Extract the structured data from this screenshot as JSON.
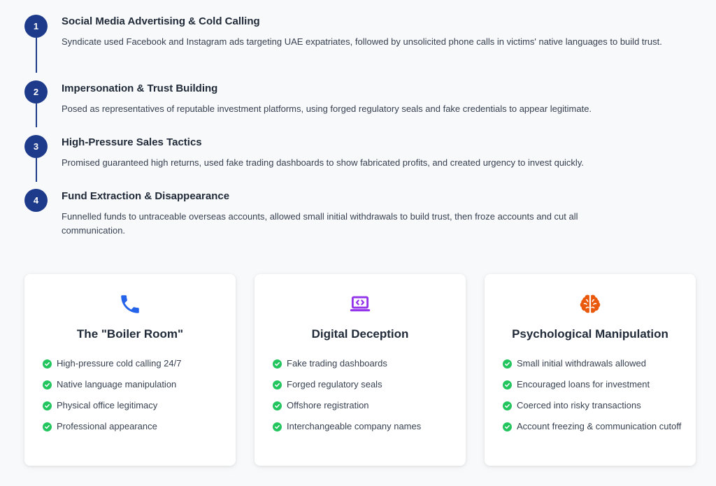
{
  "steps": [
    {
      "number": "1",
      "title": "Social Media Advertising & Cold Calling",
      "description": "Syndicate used Facebook and Instagram ads targeting UAE expatriates, followed by unsolicited phone calls in victims' native languages to build trust."
    },
    {
      "number": "2",
      "title": "Impersonation & Trust Building",
      "description": "Posed as representatives of reputable investment platforms, using forged regulatory seals and fake credentials to appear legitimate."
    },
    {
      "number": "3",
      "title": "High-Pressure Sales Tactics",
      "description": "Promised guaranteed high returns, used fake trading dashboards to show fabricated profits, and created urgency to invest quickly."
    },
    {
      "number": "4",
      "title": "Fund Extraction & Disappearance",
      "description": "Funnelled funds to untraceable overseas accounts, allowed small initial withdrawals to build trust, then froze accounts and cut all communication."
    }
  ],
  "cards": [
    {
      "icon": "phone-icon",
      "icon_color": "#2563eb",
      "title": "The \"Boiler Room\"",
      "items": [
        "High-pressure cold calling 24/7",
        "Native language manipulation",
        "Physical office legitimacy",
        "Professional appearance"
      ]
    },
    {
      "icon": "laptop-code-icon",
      "icon_color": "#9333ea",
      "title": "Digital Deception",
      "items": [
        "Fake trading dashboards",
        "Forged regulatory seals",
        "Offshore registration",
        "Interchangeable company names"
      ]
    },
    {
      "icon": "brain-icon",
      "icon_color": "#ea580c",
      "title": "Psychological Manipulation",
      "items": [
        "Small initial withdrawals allowed",
        "Encouraged loans for investment",
        "Coerced into risky transactions",
        "Account freezing & communication cutoff"
      ]
    }
  ],
  "colors": {
    "step_accent": "#1e3a8a",
    "check": "#22c55e"
  }
}
